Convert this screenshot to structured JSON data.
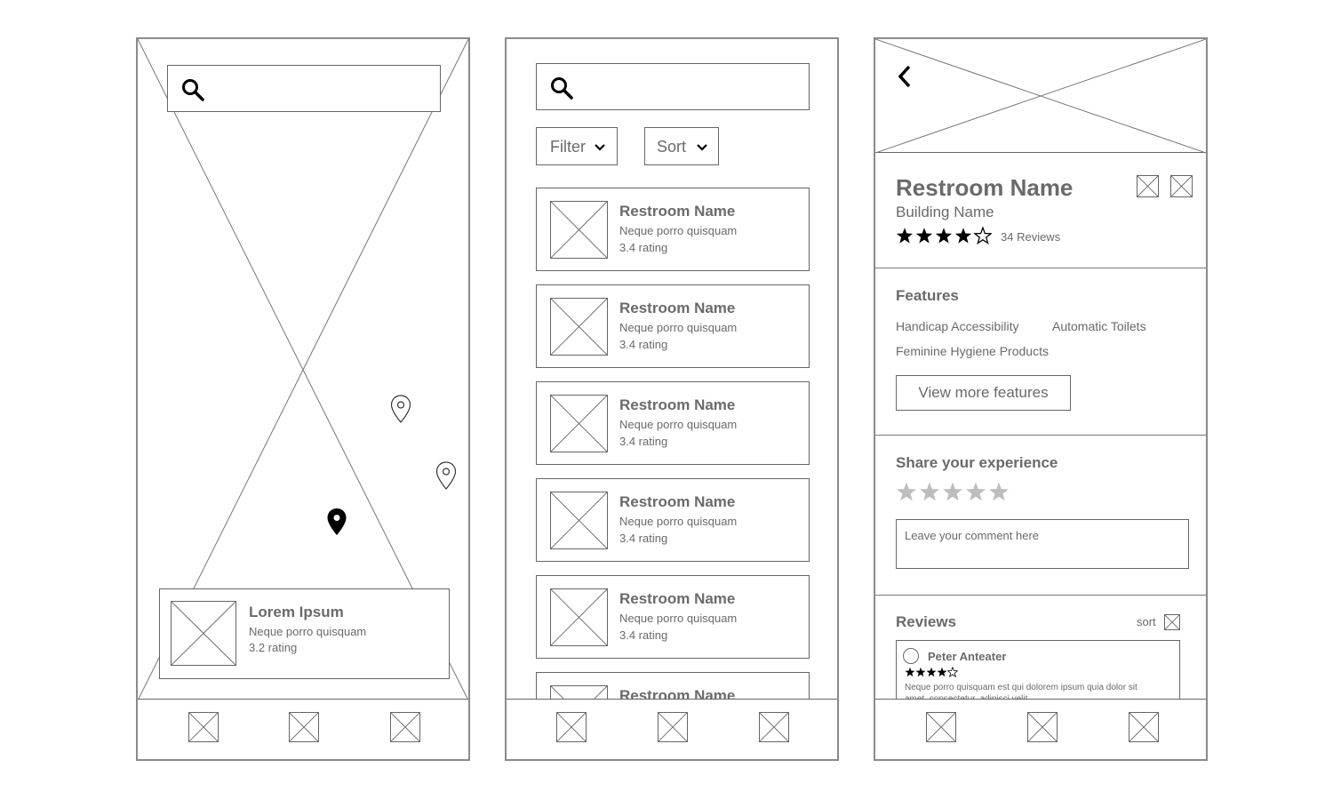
{
  "screen1": {
    "card": {
      "title": "Lorem Ipsum",
      "subtitle": "Neque porro quisquam",
      "rating": "3.2 rating"
    }
  },
  "screen2": {
    "filter_label": "Filter",
    "sort_label": "Sort",
    "items": [
      {
        "title": "Restroom Name",
        "subtitle": "Neque porro quisquam",
        "rating": "3.4 rating"
      },
      {
        "title": "Restroom Name",
        "subtitle": "Neque porro quisquam",
        "rating": "3.4 rating"
      },
      {
        "title": "Restroom Name",
        "subtitle": "Neque porro quisquam",
        "rating": "3.4 rating"
      },
      {
        "title": "Restroom Name",
        "subtitle": "Neque porro quisquam",
        "rating": "3.4 rating"
      },
      {
        "title": "Restroom Name",
        "subtitle": "Neque porro quisquam",
        "rating": "3.4 rating"
      },
      {
        "title": "Restroom Name",
        "subtitle": "",
        "rating": ""
      }
    ]
  },
  "screen3": {
    "title": "Restroom Name",
    "building": "Building Name",
    "stars_filled": 4,
    "stars_total": 5,
    "reviews_count": "34 Reviews",
    "features_heading": "Features",
    "features": [
      "Handicap Accessibility",
      "Automatic Toilets",
      "Feminine Hygiene Products"
    ],
    "view_more_label": "View more features",
    "share_heading": "Share your experience",
    "comment_placeholder": "Leave your comment here",
    "reviews_heading": "Reviews",
    "sort_label": "sort",
    "review": {
      "author": "Peter Anteater",
      "stars_filled": 4,
      "text": "Neque porro quisquam est qui dolorem ipsum quia dolor sit",
      "text_line2": "amet, consectetur, adipisci velit"
    }
  },
  "colors": {
    "outline": "#666666",
    "text": "#6a6a6a",
    "star_empty": "#bdbdbd",
    "pin_active": "#000000"
  },
  "icons": [
    "search-icon",
    "chevron-down-icon",
    "back-arrow-icon",
    "map-pin-icon",
    "star-icon",
    "image-placeholder-icon"
  ]
}
